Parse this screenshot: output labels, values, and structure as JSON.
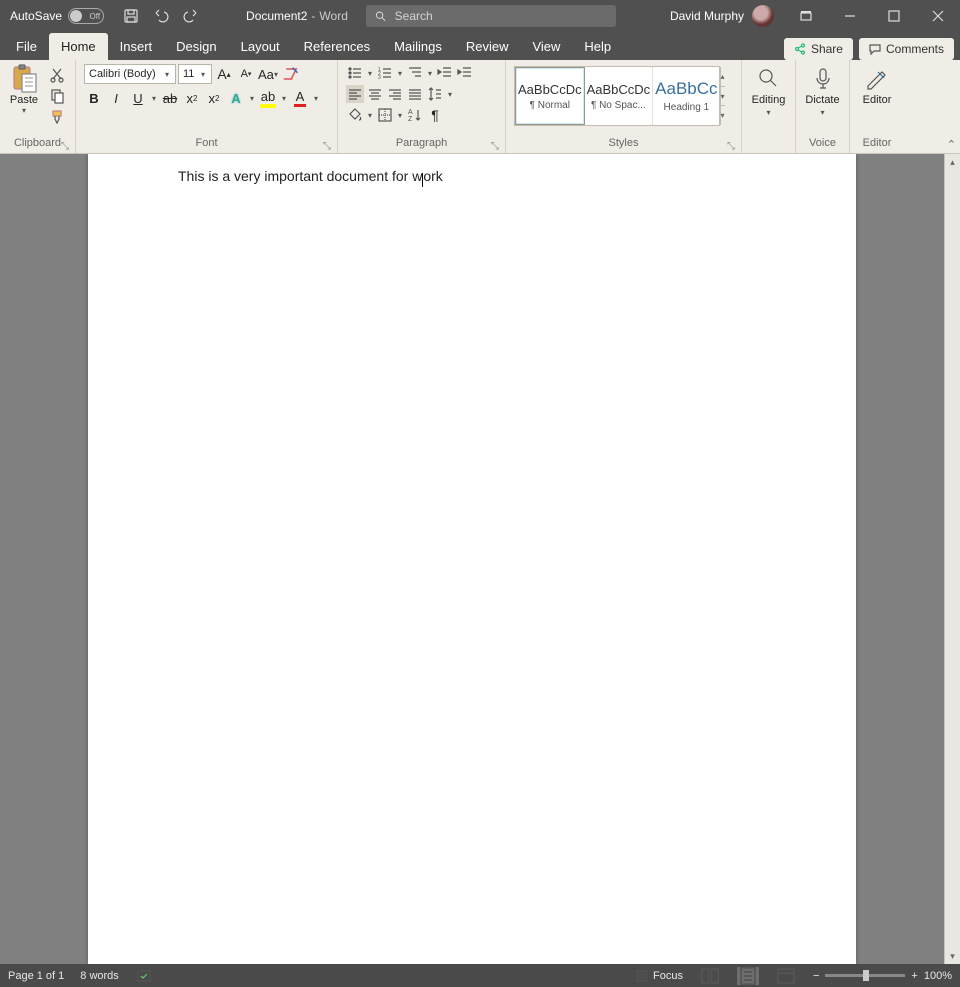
{
  "titlebar": {
    "autosave_label": "AutoSave",
    "autosave_state": "Off",
    "doc_name": "Document2",
    "app_name": "Word",
    "search_placeholder": "Search",
    "user_name": "David Murphy"
  },
  "tabs": {
    "file": "File",
    "home": "Home",
    "insert": "Insert",
    "design": "Design",
    "layout": "Layout",
    "references": "References",
    "mailings": "Mailings",
    "review": "Review",
    "view": "View",
    "help": "Help",
    "share": "Share",
    "comments": "Comments"
  },
  "ribbon": {
    "clipboard": {
      "paste": "Paste",
      "label": "Clipboard"
    },
    "font": {
      "name": "Calibri (Body)",
      "size": "11",
      "label": "Font"
    },
    "paragraph": {
      "label": "Paragraph"
    },
    "styles": {
      "label": "Styles",
      "sample": "AaBbCcDc",
      "sample_h1": "AaBbCc",
      "s1": "¶ Normal",
      "s2": "¶ No Spac...",
      "s3": "Heading 1"
    },
    "editing": {
      "label": "Editing",
      "btn": "Editing"
    },
    "voice": {
      "label": "Voice",
      "btn": "Dictate"
    },
    "editor": {
      "label": "Editor",
      "btn": "Editor"
    }
  },
  "document": {
    "text_before": "This is a very important document for w",
    "text_after": "ork"
  },
  "status": {
    "page": "Page 1 of 1",
    "words": "8 words",
    "focus": "Focus",
    "zoom": "100%"
  }
}
